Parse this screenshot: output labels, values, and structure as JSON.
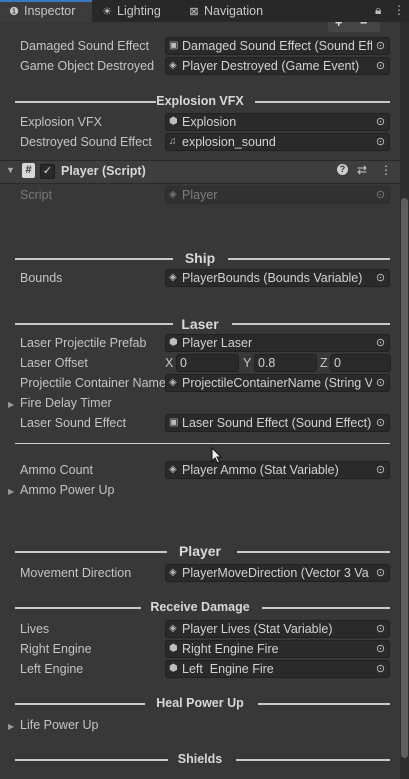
{
  "tabs": [
    {
      "label": "Inspector",
      "icon": "info-icon"
    },
    {
      "label": "Lighting",
      "icon": "lighting-icon"
    },
    {
      "label": "Navigation",
      "icon": "navigation-icon"
    }
  ],
  "rows_top": [
    {
      "label": "Damaged Sound Effect",
      "value": "Damaged Sound Effect (Sound Effe",
      "icon": "asset-icon"
    },
    {
      "label": "Game Object Destroyed",
      "value": "Player Destroyed (Game Event)",
      "icon": "asset-icon"
    }
  ],
  "explosion": {
    "header": "Explosion VFX",
    "rows": [
      {
        "label": "Explosion VFX",
        "value": "Explosion",
        "icon": "prefab-icon"
      },
      {
        "label": "Destroyed Sound Effect",
        "value": "explosion_sound",
        "icon": "audio-icon"
      }
    ]
  },
  "component": {
    "title": "Player (Script)",
    "script_label": "Script",
    "script_value": "Player"
  },
  "ship": {
    "header": "Ship",
    "rows": [
      {
        "label": "Bounds",
        "value": "PlayerBounds (Bounds Variable)"
      }
    ]
  },
  "laser": {
    "header": "Laser",
    "projectile_label": "Laser Projectile Prefab",
    "projectile_value": "Player Laser",
    "offset_label": "Laser Offset",
    "offset": {
      "x": "0",
      "y": "0.8",
      "z": "0"
    },
    "container_label": "Projectile Container Name",
    "container_value": "ProjectileContainerName (String V",
    "fire_delay_label": "Fire Delay Timer",
    "sound_label": "Laser Sound Effect",
    "sound_value": "Laser Sound Effect (Sound Effect)",
    "ammo_label": "Ammo Count",
    "ammo_value": "Player Ammo (Stat Variable)",
    "ammo_power_label": "Ammo Power Up"
  },
  "player": {
    "header": "Player",
    "movement_label": "Movement Direction",
    "movement_value": "PlayerMoveDirection (Vector 3 Va"
  },
  "receive_damage": {
    "header": "Receive Damage",
    "rows": [
      {
        "label": "Lives",
        "value": "Player Lives (Stat Variable)",
        "icon": "asset-icon"
      },
      {
        "label": "Right Engine",
        "value": "Right Engine Fire",
        "icon": "prefab-icon"
      },
      {
        "label": "Left Engine",
        "value": "Left  Engine Fire",
        "icon": "prefab-icon"
      }
    ]
  },
  "heal": {
    "header": "Heal Power Up",
    "life_label": "Life Power Up"
  },
  "shields": {
    "header": "Shields"
  }
}
